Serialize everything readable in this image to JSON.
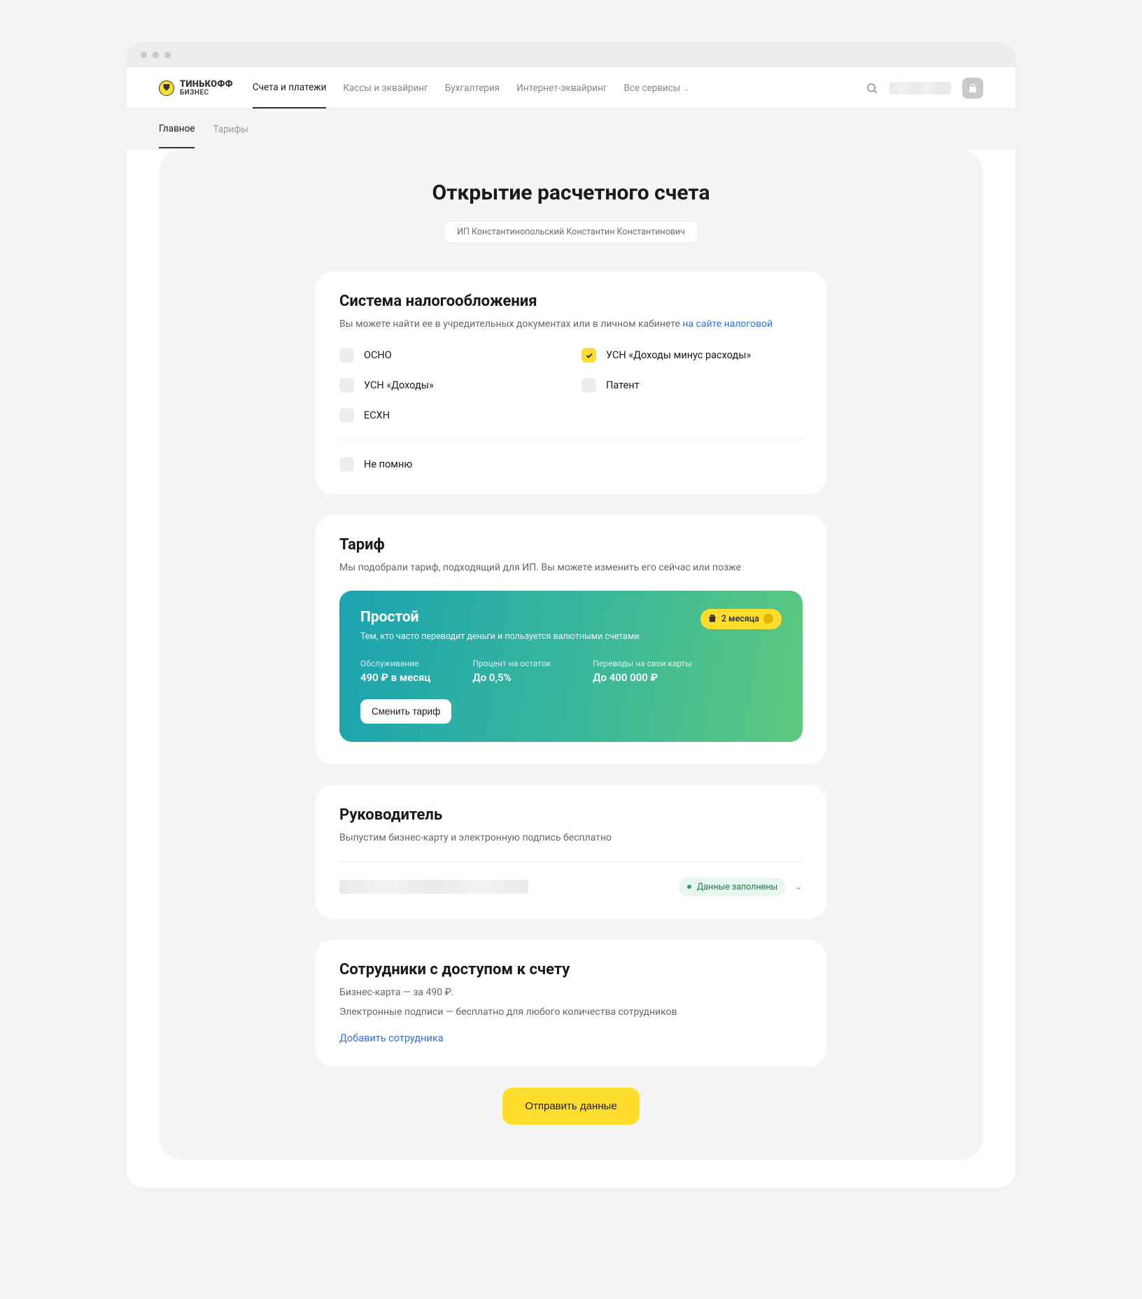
{
  "brand": {
    "name": "ТИНЬКОФФ",
    "sub": "БИЗНЕС"
  },
  "nav": {
    "items": [
      {
        "label": "Счета и платежи",
        "active": true
      },
      {
        "label": "Кассы и эквайринг"
      },
      {
        "label": "Бухгалтерия"
      },
      {
        "label": "Интернет-эквайринг"
      },
      {
        "label": "Все сервисы"
      }
    ]
  },
  "subnav": {
    "items": [
      {
        "label": "Главное",
        "active": true
      },
      {
        "label": "Тарифы"
      }
    ]
  },
  "page": {
    "title": "Открытие расчетного счета",
    "entity_chip": "ИП Константинопольский Константин Константинович"
  },
  "tax": {
    "heading": "Система налогообложения",
    "desc": "Вы можете найти ее в учредительных документах или в личном кабинете ",
    "link": "на сайте налоговой",
    "options_left": [
      "ОСНО",
      "УСН «Доходы»",
      "ЕСХН"
    ],
    "options_right": [
      "УСН «Доходы минус расходы»",
      "Патент"
    ],
    "selected": "УСН «Доходы минус расходы»",
    "forgot": "Не помню"
  },
  "tariff": {
    "heading": "Тариф",
    "desc": "Мы подобрали тариф, подходящий для ИП. Вы можете изменить его сейчас или позже",
    "name": "Простой",
    "subtitle": "Тем, кто часто переводит деньги и пользуется валютными счетами",
    "promo": "2 месяца",
    "cols": [
      {
        "label": "Обслуживание",
        "value": "490 ₽ в месяц"
      },
      {
        "label": "Процент на остаток",
        "value": "До 0,5%"
      },
      {
        "label": "Переводы на свои карты",
        "value": "До 400 000 ₽"
      }
    ],
    "change_btn": "Сменить тариф"
  },
  "leader": {
    "heading": "Руководитель",
    "desc": "Выпустим бизнес-карту и электронную подпись бесплатно",
    "status": "Данные заполнены"
  },
  "staff": {
    "heading": "Сотрудники с доступом к счету",
    "line1": "Бизнес-карта — за 490 ₽.",
    "line2": "Электронные подписи — бесплатно для любого количества сотрудников",
    "add": "Добавить сотрудника"
  },
  "submit": "Отправить данные"
}
